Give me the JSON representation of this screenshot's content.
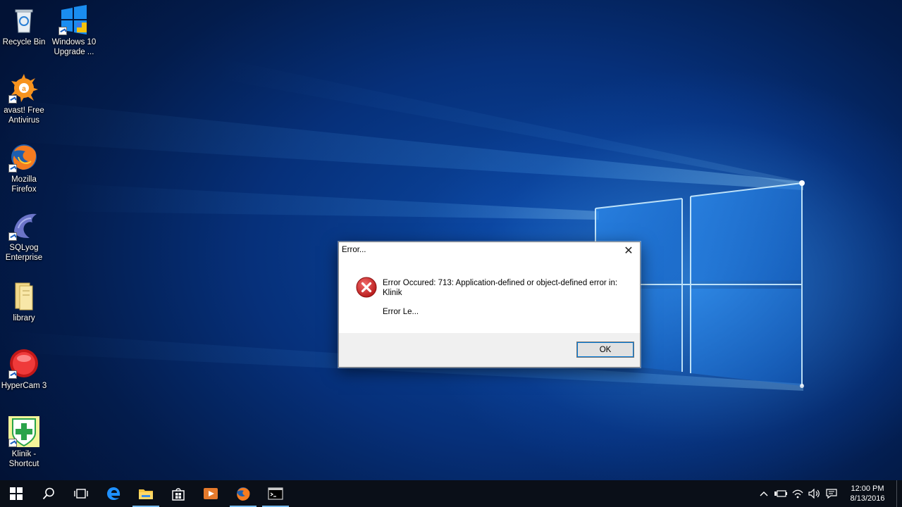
{
  "desktop": {
    "icons": [
      {
        "label": "Recycle Bin",
        "icon": "recycle-bin-icon"
      },
      {
        "label": "Windows 10 Upgrade ...",
        "icon": "windows-logo-icon"
      },
      {
        "label": "avast! Free Antivirus",
        "icon": "avast-icon"
      },
      {
        "label": "Mozilla Firefox",
        "icon": "firefox-icon"
      },
      {
        "label": "SQLyog Enterprise",
        "icon": "dolphin-icon"
      },
      {
        "label": "library",
        "icon": "folder-icon"
      },
      {
        "label": "HyperCam 3",
        "icon": "record-icon"
      },
      {
        "label": "Klinik - Shortcut",
        "icon": "klinik-icon"
      }
    ]
  },
  "dialog": {
    "title": "Error...",
    "close_glyph": "✕",
    "message": "Error Occured: 713: Application-defined or object-defined error in: Klinik",
    "message2": "Error Le...",
    "ok_label": "OK"
  },
  "taskbar": {
    "items": [
      {
        "name": "start",
        "icon": "windows-start-icon"
      },
      {
        "name": "search",
        "icon": "search-icon"
      },
      {
        "name": "task-view",
        "icon": "task-view-icon"
      },
      {
        "name": "edge",
        "icon": "edge-icon"
      },
      {
        "name": "file-explorer",
        "icon": "folder-icon"
      },
      {
        "name": "store",
        "icon": "store-icon"
      },
      {
        "name": "media-player",
        "icon": "media-player-icon"
      },
      {
        "name": "firefox",
        "icon": "firefox-icon"
      },
      {
        "name": "console",
        "icon": "console-icon"
      }
    ],
    "tray": {
      "chevron": "^",
      "time": "12:00 PM",
      "date": "8/13/2016"
    }
  },
  "colors": {
    "accent": "#0078d7",
    "taskbar": "#0a0f18",
    "error_red": "#d32f2f"
  }
}
